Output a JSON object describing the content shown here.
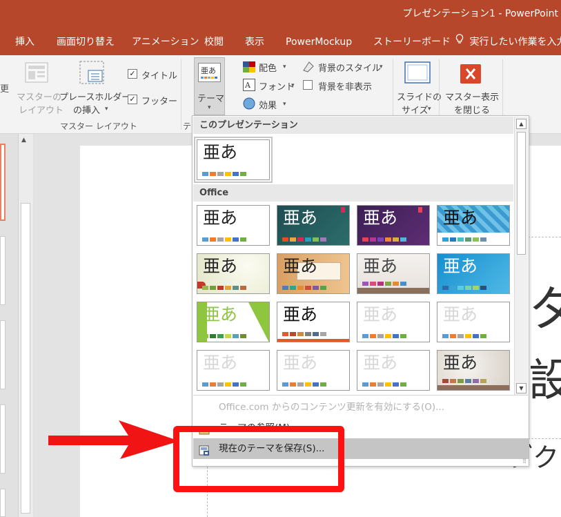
{
  "window": {
    "title": "プレゼンテーション1 - PowerPoint"
  },
  "tabs": [
    {
      "label": "挿入"
    },
    {
      "label": "画面切り替え"
    },
    {
      "label": "アニメーション"
    },
    {
      "label": "校閲"
    },
    {
      "label": "表示"
    },
    {
      "label": "PowerMockup"
    },
    {
      "label": "ストーリーボード"
    }
  ],
  "tell_me": {
    "text": "実行したい作業を入力"
  },
  "ribbon": {
    "master_layout": {
      "edge_char": "更",
      "master_layout_label_1": "マスターの",
      "master_layout_label_2": "レイアウト",
      "insert_placeholder_label_1": "プレースホルダー",
      "insert_placeholder_label_2": "の挿入",
      "title_checkbox": "タイトル",
      "footer_checkbox": "フッター",
      "caption": "マスター レイアウト"
    },
    "theme_group": {
      "themes_label": "テーマ",
      "caption_fragment": "テ",
      "colors_label": "配色",
      "fonts_label": "フォント",
      "effects_label": "効果",
      "bg_styles_label": "背景のスタイル",
      "hide_bg_label": "背景を非表示"
    },
    "size": {
      "label_1": "スライドの",
      "label_2": "サイズ"
    },
    "close": {
      "label_1": "マスター表示",
      "label_2": "を閉じる"
    }
  },
  "slide_text": {
    "glyph_1": "タ",
    "glyph_2": "設",
    "glyph_3": "ブク"
  },
  "dropdown": {
    "section_this": "このプレゼンテーション",
    "section_office": "Office",
    "theme_sample": "亜あ",
    "menu": {
      "update": "Office.com からのコンテンツ更新を有効にする(O)...",
      "browse": "テーマの参照(M)...",
      "save": "現在のテーマを保存(S)..."
    }
  },
  "colors": {
    "accent": "#b7472a",
    "highlight_frame": "#ff1111",
    "menu_highlight": "#c5c5c5"
  }
}
